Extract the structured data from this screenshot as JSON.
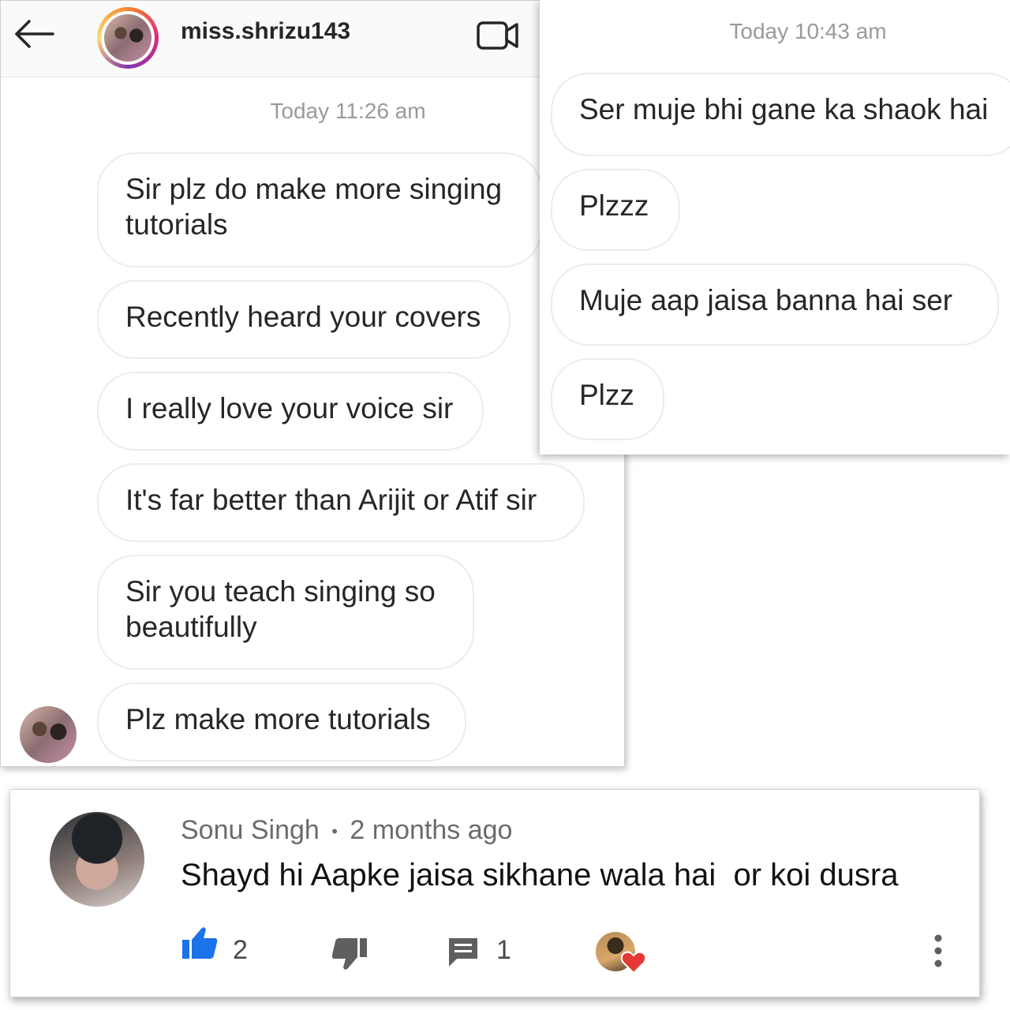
{
  "dm_left": {
    "username": "miss.shrizu143",
    "timestamp": "Today 11:26 am",
    "messages": [
      "Sir plz do make more singing\ntutorials",
      "Recently heard your covers",
      "I really love your voice sir",
      "It's far better than Arijit or Atif sir",
      "Sir you teach singing so\nbeautifully",
      "Plz make more tutorials"
    ],
    "icons": {
      "back": "arrow-left-icon",
      "video": "video-camera-icon",
      "avatar": "profile-avatar"
    }
  },
  "dm_right": {
    "timestamp": "Today 10:43 am",
    "messages": [
      "Ser muje bhi gane ka shaok hai",
      "Plzzz",
      "Muje aap jaisa banna hai ser",
      "Plzz"
    ]
  },
  "comment": {
    "author": "Sonu Singh",
    "separator": "•",
    "time_ago": "2 months ago",
    "text": "Shayd hi Aapke jaisa sikhane wala hai  or koi dusra",
    "likes": "2",
    "replies": "1",
    "icons": {
      "like": "thumbs-up-icon",
      "dislike": "thumbs-down-icon",
      "reply": "comment-icon",
      "heart": "creator-heart-icon",
      "more": "more-vertical-icon"
    },
    "colors": {
      "like_active": "#1a73e8",
      "heart": "#e53935"
    }
  }
}
